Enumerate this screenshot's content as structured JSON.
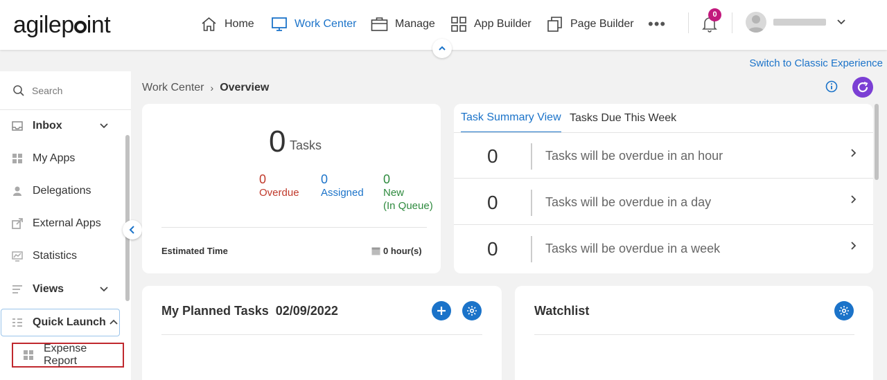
{
  "brand": {
    "logo_text_a": "agilep",
    "logo_text_b": "int"
  },
  "nav": {
    "home": "Home",
    "work_center": "Work Center",
    "manage": "Manage",
    "app_builder": "App Builder",
    "page_builder": "Page Builder",
    "more": "•••",
    "notif_count": "0",
    "accent": "#1b73c9"
  },
  "switch_link": "Switch to Classic Experience",
  "sidebar": {
    "search_placeholder": "Search",
    "items": [
      {
        "label": "Inbox"
      },
      {
        "label": "My Apps"
      },
      {
        "label": "Delegations"
      },
      {
        "label": "External Apps"
      },
      {
        "label": "Statistics"
      },
      {
        "label": "Views"
      },
      {
        "label": "Quick Launch"
      }
    ],
    "quick_launch_child": "Expense Report"
  },
  "breadcrumb": {
    "root": "Work Center",
    "sep": "›",
    "current": "Overview"
  },
  "tasks_card": {
    "total": "0",
    "total_label": "Tasks",
    "overdue_num": "0",
    "overdue_label": "Overdue",
    "assigned_num": "0",
    "assigned_label": "Assigned",
    "new_num": "0",
    "new_label": "New",
    "new_sub": "(In Queue)",
    "est_label": "Estimated Time",
    "est_value": "0 hour(s)"
  },
  "summary": {
    "tabs": [
      "Task Summary View",
      "Tasks Due This Week"
    ],
    "rows": [
      {
        "count": "0",
        "text": "Tasks will be overdue in an hour"
      },
      {
        "count": "0",
        "text": "Tasks will be overdue in a day"
      },
      {
        "count": "0",
        "text": "Tasks will be overdue in a week"
      }
    ]
  },
  "planned": {
    "title": "My Planned Tasks",
    "date": "02/09/2022"
  },
  "watchlist": {
    "title": "Watchlist"
  }
}
